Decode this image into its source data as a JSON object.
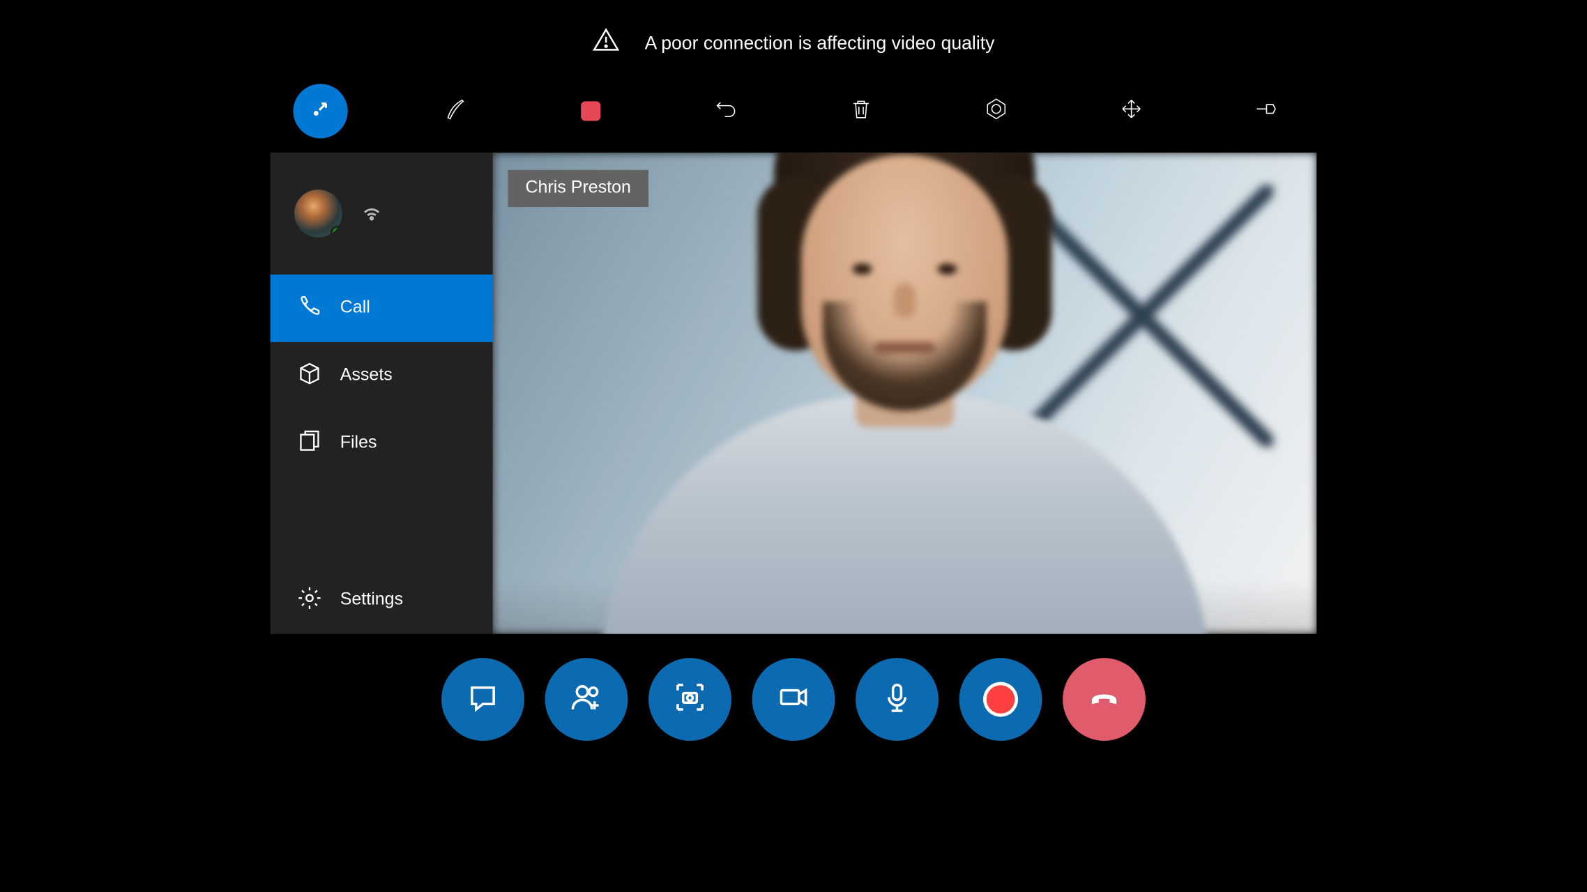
{
  "warning": {
    "text": "A poor connection is affecting video quality"
  },
  "toolbar": {
    "items": [
      {
        "name": "pointer",
        "active": true
      },
      {
        "name": "pen",
        "active": false
      },
      {
        "name": "stop",
        "active": false
      },
      {
        "name": "undo",
        "active": false
      },
      {
        "name": "delete",
        "active": false
      },
      {
        "name": "auto",
        "active": false
      },
      {
        "name": "expand",
        "active": false
      },
      {
        "name": "pin",
        "active": false
      }
    ]
  },
  "sidebar": {
    "items": [
      {
        "label": "Call",
        "icon": "phone",
        "active": true
      },
      {
        "label": "Assets",
        "icon": "package",
        "active": false
      },
      {
        "label": "Files",
        "icon": "files",
        "active": false
      },
      {
        "label": "Settings",
        "icon": "gear",
        "active": false
      }
    ]
  },
  "video": {
    "participant_name": "Chris Preston"
  },
  "call_controls": [
    {
      "name": "chat"
    },
    {
      "name": "add-participant"
    },
    {
      "name": "screenshot"
    },
    {
      "name": "video-toggle"
    },
    {
      "name": "mic-toggle"
    },
    {
      "name": "record"
    },
    {
      "name": "end-call"
    }
  ]
}
